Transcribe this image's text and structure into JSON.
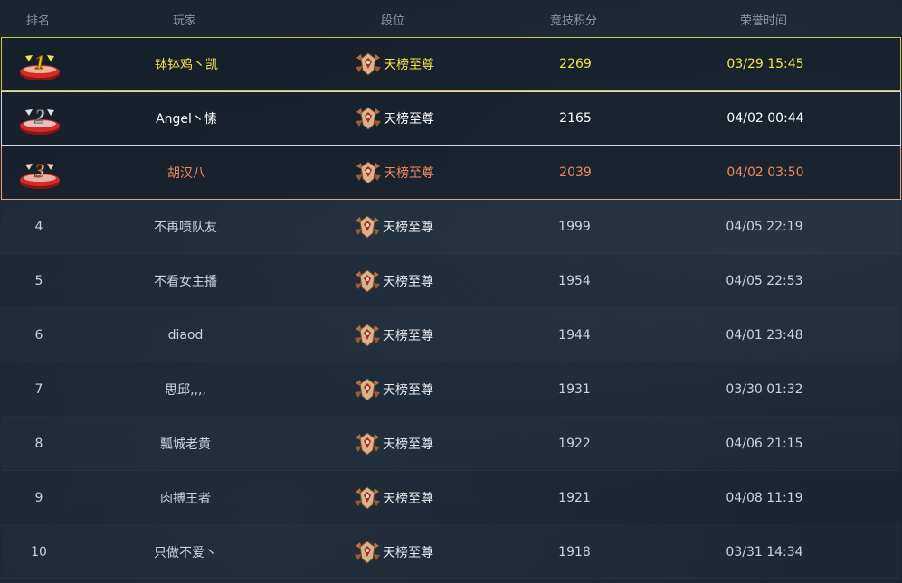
{
  "header": {
    "rank": "排名",
    "player": "玩家",
    "tier": "段位",
    "score": "竞技积分",
    "time": "荣誉时间"
  },
  "rows": [
    {
      "rank": "1",
      "player": "钵钵鸡丶凯",
      "tier": "天榜至尊",
      "score": "2269",
      "time": "03/29 15:45"
    },
    {
      "rank": "2",
      "player": "Angel丶愫",
      "tier": "天榜至尊",
      "score": "2165",
      "time": "04/02 00:44"
    },
    {
      "rank": "3",
      "player": "胡汉八",
      "tier": "天榜至尊",
      "score": "2039",
      "time": "04/02 03:50"
    },
    {
      "rank": "4",
      "player": "不再喷队友",
      "tier": "天榜至尊",
      "score": "1999",
      "time": "04/05 22:19"
    },
    {
      "rank": "5",
      "player": "不看女主播",
      "tier": "天榜至尊",
      "score": "1954",
      "time": "04/05 22:53"
    },
    {
      "rank": "6",
      "player": "diaod",
      "tier": "天榜至尊",
      "score": "1944",
      "time": "04/01 23:48"
    },
    {
      "rank": "7",
      "player": "思邱,,,,",
      "tier": "天榜至尊",
      "score": "1931",
      "time": "03/30 01:32"
    },
    {
      "rank": "8",
      "player": "瓢城老黄",
      "tier": "天榜至尊",
      "score": "1922",
      "time": "04/06 21:15"
    },
    {
      "rank": "9",
      "player": "肉搏王者",
      "tier": "天榜至尊",
      "score": "1921",
      "time": "04/08 11:19"
    },
    {
      "rank": "10",
      "player": "只做不爱丶",
      "tier": "天榜至尊",
      "score": "1918",
      "time": "03/31 14:34"
    }
  ],
  "medal_icons": [
    "gold-medal-icon",
    "silver-medal-icon",
    "bronze-medal-icon"
  ],
  "tier_icon": "tier-emblem-icon",
  "colors": {
    "gold": "#f3e34a",
    "silver": "#ffffff",
    "bronze": "#f08a5d",
    "gold_border": "#d8c34a",
    "silver_border": "#d5d9de",
    "bronze_border": "#e3a27a",
    "background": "#1b2632"
  }
}
